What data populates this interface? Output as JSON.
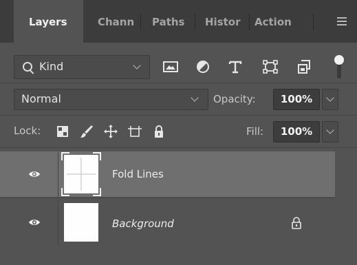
{
  "tabs": [
    {
      "label": "Layers",
      "active": true
    },
    {
      "label": "Chann",
      "active": false
    },
    {
      "label": "Paths",
      "active": false
    },
    {
      "label": "Histor",
      "active": false
    },
    {
      "label": "Action",
      "active": false
    }
  ],
  "panel_menu_icon": "hamburger-icon",
  "filter": {
    "kind_label": "Kind",
    "search_icon": "search-icon",
    "icons": [
      "image-filter-icon",
      "adjustment-filter-icon",
      "type-filter-icon",
      "shape-filter-icon",
      "smart-object-filter-icon"
    ],
    "toggle_on": true
  },
  "blending": {
    "mode": "Normal",
    "opacity_label": "Opacity:",
    "opacity_value": "100%"
  },
  "lock": {
    "label": "Lock:",
    "icons": [
      "lock-transparent-pixels-icon",
      "lock-image-pixels-icon",
      "lock-position-icon",
      "lock-artboard-icon",
      "lock-all-icon"
    ],
    "fill_label": "Fill:",
    "fill_value": "100%"
  },
  "layers": [
    {
      "name": "Fold Lines",
      "selected": true,
      "visible": true,
      "locked": false,
      "italic": false,
      "thumbnail": "fold-lines"
    },
    {
      "name": "Background",
      "selected": false,
      "visible": true,
      "locked": true,
      "italic": true,
      "thumbnail": "white"
    }
  ],
  "colors": {
    "panel_bg": "#535353",
    "tab_bar_bg": "#3c3c3c",
    "selected_layer_bg": "#6f6f6f"
  }
}
